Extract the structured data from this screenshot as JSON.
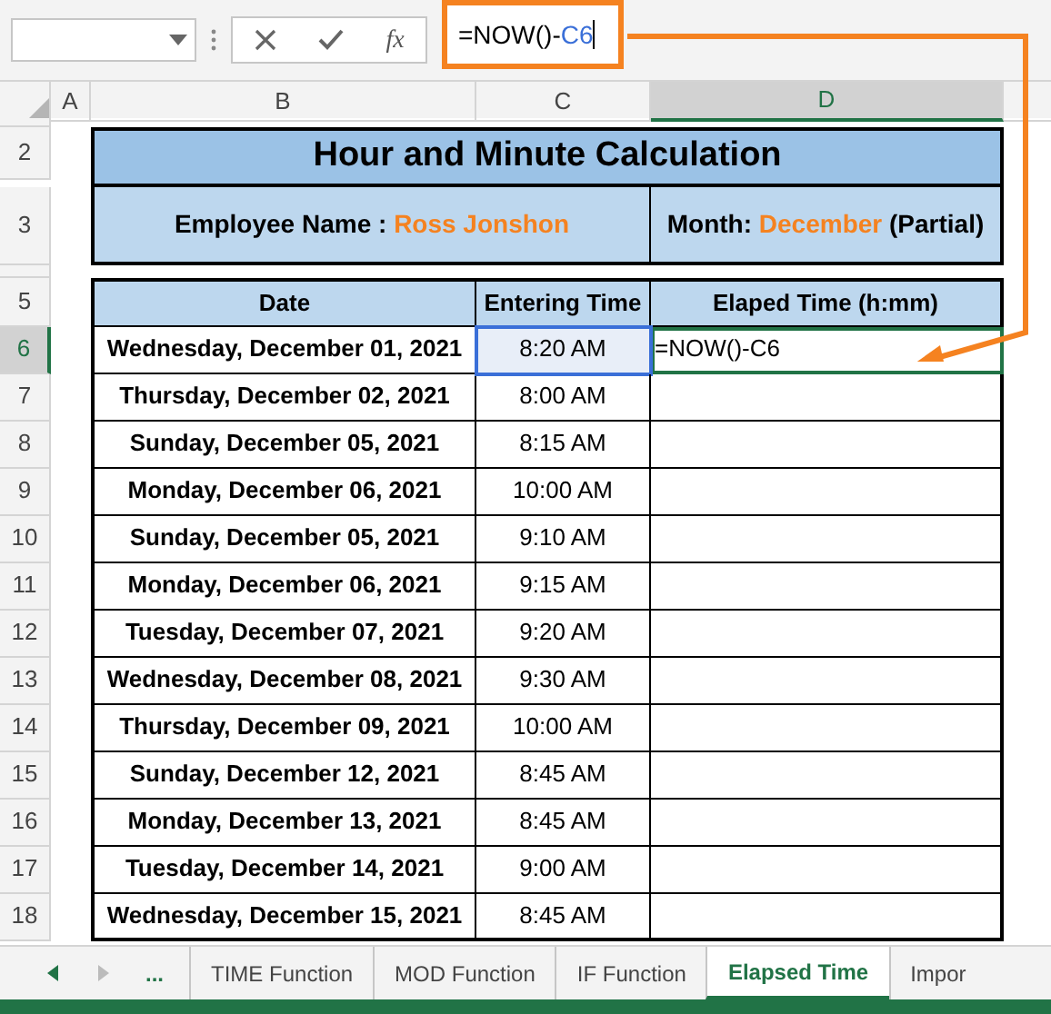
{
  "formula_bar": {
    "fx": "fx",
    "formula": [
      {
        "kind": "plain",
        "text": "=NOW()-"
      },
      {
        "kind": "ref",
        "text": "C6"
      }
    ]
  },
  "columns": [
    {
      "label": "A",
      "selected": false
    },
    {
      "label": "B",
      "selected": false
    },
    {
      "label": "C",
      "selected": false
    },
    {
      "label": "D",
      "selected": true
    }
  ],
  "title": "Hour and Minute Calculation",
  "employee": {
    "label": "Employee Name : ",
    "value": "Ross Jonshon"
  },
  "month": {
    "label": "Month: ",
    "value": "December",
    "suffix": "(Partial)"
  },
  "title_row_numbers": [
    "2",
    "3"
  ],
  "header_row_number": "5",
  "headers": [
    "Date",
    "Entering Time",
    "Elaped Time (h:mm)"
  ],
  "rows": [
    {
      "number": "6",
      "selected": true,
      "date": "Wednesday, December 01, 2021",
      "time": "8:20 AM",
      "time_referenced": true,
      "elapsed": "=NOW()-C6",
      "elapsed_editing": true
    },
    {
      "number": "7",
      "selected": false,
      "date": "Thursday, December 02, 2021",
      "time": "8:00 AM",
      "time_referenced": false,
      "elapsed_editing": false
    },
    {
      "number": "8",
      "selected": false,
      "date": "Sunday, December 05, 2021",
      "time": "8:15 AM",
      "time_referenced": false,
      "elapsed_editing": false
    },
    {
      "number": "9",
      "selected": false,
      "date": "Monday, December 06, 2021",
      "time": "10:00 AM",
      "time_referenced": false,
      "elapsed_editing": false
    },
    {
      "number": "10",
      "selected": false,
      "date": "Sunday, December 05, 2021",
      "time": "9:10 AM",
      "time_referenced": false,
      "elapsed_editing": false
    },
    {
      "number": "11",
      "selected": false,
      "date": "Monday, December 06, 2021",
      "time": "9:15 AM",
      "time_referenced": false,
      "elapsed_editing": false
    },
    {
      "number": "12",
      "selected": false,
      "date": "Tuesday, December 07, 2021",
      "time": "9:20 AM",
      "time_referenced": false,
      "elapsed_editing": false
    },
    {
      "number": "13",
      "selected": false,
      "date": "Wednesday, December 08, 2021",
      "time": "9:30 AM",
      "time_referenced": false,
      "elapsed_editing": false
    },
    {
      "number": "14",
      "selected": false,
      "date": "Thursday, December 09, 2021",
      "time": "10:00 AM",
      "time_referenced": false,
      "elapsed_editing": false
    },
    {
      "number": "15",
      "selected": false,
      "date": "Sunday, December 12, 2021",
      "time": "8:45 AM",
      "time_referenced": false,
      "elapsed_editing": false
    },
    {
      "number": "16",
      "selected": false,
      "date": "Monday, December 13, 2021",
      "time": "8:45 AM",
      "time_referenced": false,
      "elapsed_editing": false
    },
    {
      "number": "17",
      "selected": false,
      "date": "Tuesday, December 14, 2021",
      "time": "9:00 AM",
      "time_referenced": false,
      "elapsed_editing": false
    },
    {
      "number": "18",
      "selected": false,
      "date": "Wednesday, December 15, 2021",
      "time": "8:45 AM",
      "time_referenced": false,
      "elapsed_editing": false
    }
  ],
  "sheet_nav": {
    "more": "..."
  },
  "sheet_tabs": [
    {
      "label": "TIME Function",
      "selected": false
    },
    {
      "label": "MOD Function",
      "selected": false
    },
    {
      "label": "IF Function",
      "selected": false
    },
    {
      "label": "Elapsed Time",
      "selected": true
    },
    {
      "label": "Impor",
      "selected": false
    }
  ]
}
